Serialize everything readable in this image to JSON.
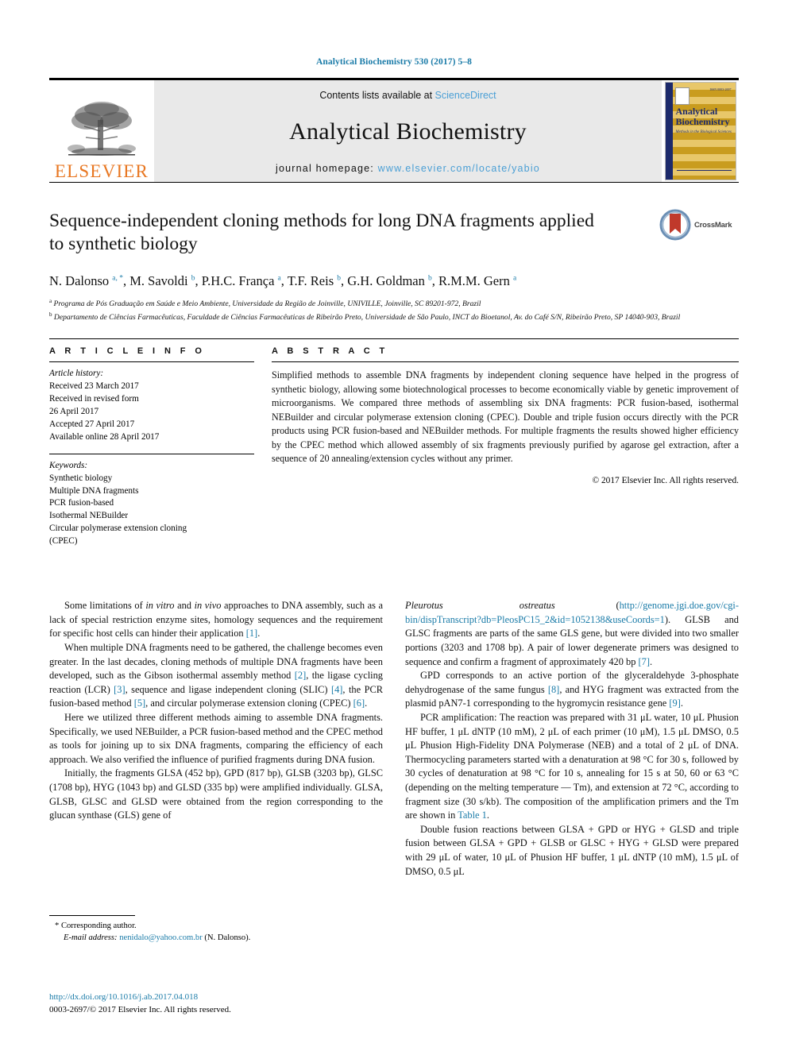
{
  "running_head": "Analytical Biochemistry 530 (2017) 5–8",
  "masthead": {
    "publisher_name": "ELSEVIER",
    "contents_prefix": "Contents lists available at ",
    "contents_link": "ScienceDirect",
    "journal_title": "Analytical Biochemistry",
    "homepage_prefix": "journal homepage: ",
    "homepage_url": "www.elsevier.com/locate/yabio",
    "cover": {
      "title_line1": "Analytical",
      "title_line2": "Biochemistry",
      "subtitle": "Methods in the Biological Sciences"
    }
  },
  "article": {
    "title": "Sequence-independent cloning methods for long DNA fragments applied to synthetic biology",
    "crossmark_label": "CrossMark",
    "authors_html": "N. Dalonso <sup>a, *</sup>, M. Savoldi <sup>b</sup>, P.H.C. França <sup>a</sup>, T.F. Reis <sup>b</sup>, G.H. Goldman <sup>b</sup>, R.M.M. Gern <sup>a</sup>",
    "affiliation_a": "Programa de Pós Graduação em Saúde e Meio Ambiente, Universidade da Região de Joinville, UNIVILLE, Joinville, SC 89201-972, Brazil",
    "affiliation_b": "Departamento de Ciências Farmacêuticas, Faculdade de Ciências Farmacêuticas de Ribeirão Preto, Universidade de São Paulo, INCT do Bioetanol, Av. do Café S/N, Ribeirão Preto, SP 14040-903, Brazil"
  },
  "article_info": {
    "heading": "A R T I C L E   I N F O",
    "history_label": "Article history:",
    "history_lines": [
      "Received 23 March 2017",
      "Received in revised form",
      "26 April 2017",
      "Accepted 27 April 2017",
      "Available online 28 April 2017"
    ],
    "keywords_label": "Keywords:",
    "keywords": [
      "Synthetic biology",
      "Multiple DNA fragments",
      "PCR fusion-based",
      "Isothermal NEBuilder",
      "Circular polymerase extension cloning",
      "(CPEC)"
    ]
  },
  "abstract": {
    "heading": "A B S T R A C T",
    "text": "Simplified methods to assemble DNA fragments by independent cloning sequence have helped in the progress of synthetic biology, allowing some biotechnological processes to become economically viable by genetic improvement of microorganisms. We compared three methods of assembling six DNA fragments: PCR fusion-based, isothermal NEBuilder and circular polymerase extension cloning (CPEC). Double and triple fusion occurs directly with the PCR products using PCR fusion-based and NEBuilder methods. For multiple fragments the results showed higher efficiency by the CPEC method which allowed assembly of six fragments previously purified by agarose gel extraction, after a sequence of 20 annealing/extension cycles without any primer.",
    "copyright": "© 2017 Elsevier Inc. All rights reserved."
  },
  "body": {
    "left_paragraphs": [
      {
        "id": "p1",
        "html": "Some limitations of <span class=\"ital\">in vitro</span> and <span class=\"ital\">in vivo</span> approaches to DNA assembly, such as a lack of special restriction enzyme sites, homology sequences and the requirement for specific host cells can hinder their application <span class=\"reflink\">[1]</span>."
      },
      {
        "id": "p2",
        "html": "When multiple DNA fragments need to be gathered, the challenge becomes even greater. In the last decades, cloning methods of multiple DNA fragments have been developed, such as the Gibson isothermal assembly method <span class=\"reflink\">[2]</span>, the ligase cycling reaction (LCR) <span class=\"reflink\">[3]</span>, sequence and ligase independent cloning (SLIC) <span class=\"reflink\">[4]</span>, the PCR fusion-based method <span class=\"reflink\">[5]</span>, and circular polymerase extension cloning (CPEC) <span class=\"reflink\">[6]</span>."
      },
      {
        "id": "p3",
        "html": "Here we utilized three different methods aiming to assemble DNA fragments. Specifically, we used NEBuilder, a PCR fusion-based method and the CPEC method as tools for joining up to six DNA fragments, comparing the efficiency of each approach. We also verified the influence of purified fragments during DNA fusion."
      },
      {
        "id": "p4",
        "html": "Initially, the fragments GLSA (452 bp), GPD (817 bp), GLSB (3203 bp), GLSC (1708 bp), HYG (1043 bp) and GLSD (335 bp) were amplified individually. GLSA, GLSB, GLSC and GLSD were obtained from the region corresponding to the glucan synthase (GLS) gene of"
      }
    ],
    "right_paragraphs": [
      {
        "id": "r1",
        "noindent": true,
        "html": "<span class=\"ital\">Pleurotus&nbsp;&nbsp;&nbsp;&nbsp;&nbsp;&nbsp;&nbsp;&nbsp;&nbsp;&nbsp;&nbsp;&nbsp;&nbsp;&nbsp;&nbsp;ostreatus</span>&nbsp;&nbsp;&nbsp;&nbsp;&nbsp;&nbsp;&nbsp;&nbsp;&nbsp;&nbsp;&nbsp;&nbsp;(<span class=\"reflink\">http://genome.jgi.doe.gov/cgi-bin/dispTranscript?db=PleosPC15_2&amp;id=1052138&amp;useCoords=1</span>). GLSB and GLSC fragments are parts of the same GLS gene, but were divided into two smaller portions (3203 and 1708 bp). A pair of lower degenerate primers was designed to sequence and confirm a fragment of approximately 420 bp <span class=\"reflink\">[7]</span>."
      },
      {
        "id": "r2",
        "html": "GPD corresponds to an active portion of the glyceraldehyde 3-phosphate dehydrogenase of the same fungus <span class=\"reflink\">[8]</span>, and HYG fragment was extracted from the plasmid pAN7-1 corresponding to the hygromycin resistance gene <span class=\"reflink\">[9]</span>."
      },
      {
        "id": "r3",
        "html": "PCR amplification: The reaction was prepared with 31 μL water, 10 μL Phusion HF buffer, 1 μL dNTP (10 mM), 2 μL of each primer (10 μM), 1.5 μL DMSO, 0.5 μL Phusion High-Fidelity DNA Polymerase (NEB) and a total of 2 μL of DNA. Thermocycling parameters started with a denaturation at 98 °C for 30 s, followed by 30 cycles of denaturation at 98 °C for 10 s, annealing for 15 s at 50, 60 or 63 °C (depending on the melting temperature — Tm), and extension at 72 °C, according to fragment size (30 s/kb). The composition of the amplification primers and the Tm are shown in <span class=\"reflink\">Table 1</span>."
      },
      {
        "id": "r4",
        "html": "Double fusion reactions between GLSA + GPD or HYG + GLSD and triple fusion between GLSA + GPD + GLSB or GLSC + HYG + GLSD were prepared with 29 μL of water, 10 μL of Phusion HF buffer, 1 μL dNTP (10 mM), 1.5 μL of DMSO, 0.5 μL"
      }
    ]
  },
  "footnote": {
    "corresponding": "* Corresponding author.",
    "email_label": "E-mail address:",
    "email": "nenidalo@yahoo.com.br",
    "email_suffix": "(N. Dalonso)."
  },
  "doi_block": {
    "doi": "http://dx.doi.org/10.1016/j.ab.2017.04.018",
    "issn_line": "0003-2697/© 2017 Elsevier Inc. All rights reserved."
  },
  "colors": {
    "link_blue": "#1a7ba8",
    "sciencedirect_blue": "#4a9fd5",
    "elsevier_orange": "#E87722",
    "masthead_gray": "#e9e9e9",
    "crossmark_red": "#c0392b"
  }
}
